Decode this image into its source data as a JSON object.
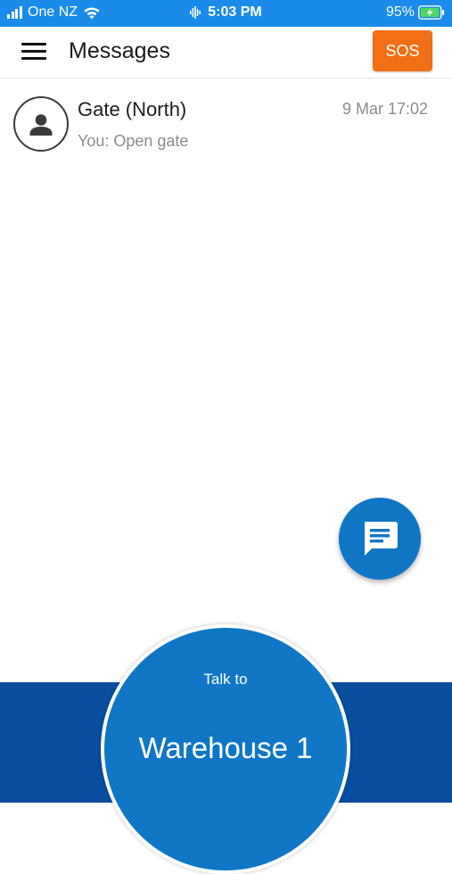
{
  "status_bar": {
    "carrier": "One NZ",
    "time": "5:03 PM",
    "battery": "95%",
    "icons": [
      "signal-icon",
      "wifi-icon",
      "microphone-activity-icon",
      "battery-charging-icon"
    ],
    "color": "#1a8be8"
  },
  "header": {
    "title": "Messages",
    "menu_icon": "hamburger-menu-icon",
    "sos_label": "SOS",
    "sos_color": "#f26f16"
  },
  "conversations": [
    {
      "name": "Gate (North)",
      "preview": "You: Open gate",
      "time": "9 Mar 17:02",
      "avatar_icon": "person-icon"
    }
  ],
  "fab": {
    "icon": "chat-message-icon",
    "color": "#1076c6"
  },
  "talk": {
    "label": "Talk to",
    "target": "Warehouse 1",
    "button_color": "#1076c6",
    "bar_color": "#0a4ea0"
  }
}
